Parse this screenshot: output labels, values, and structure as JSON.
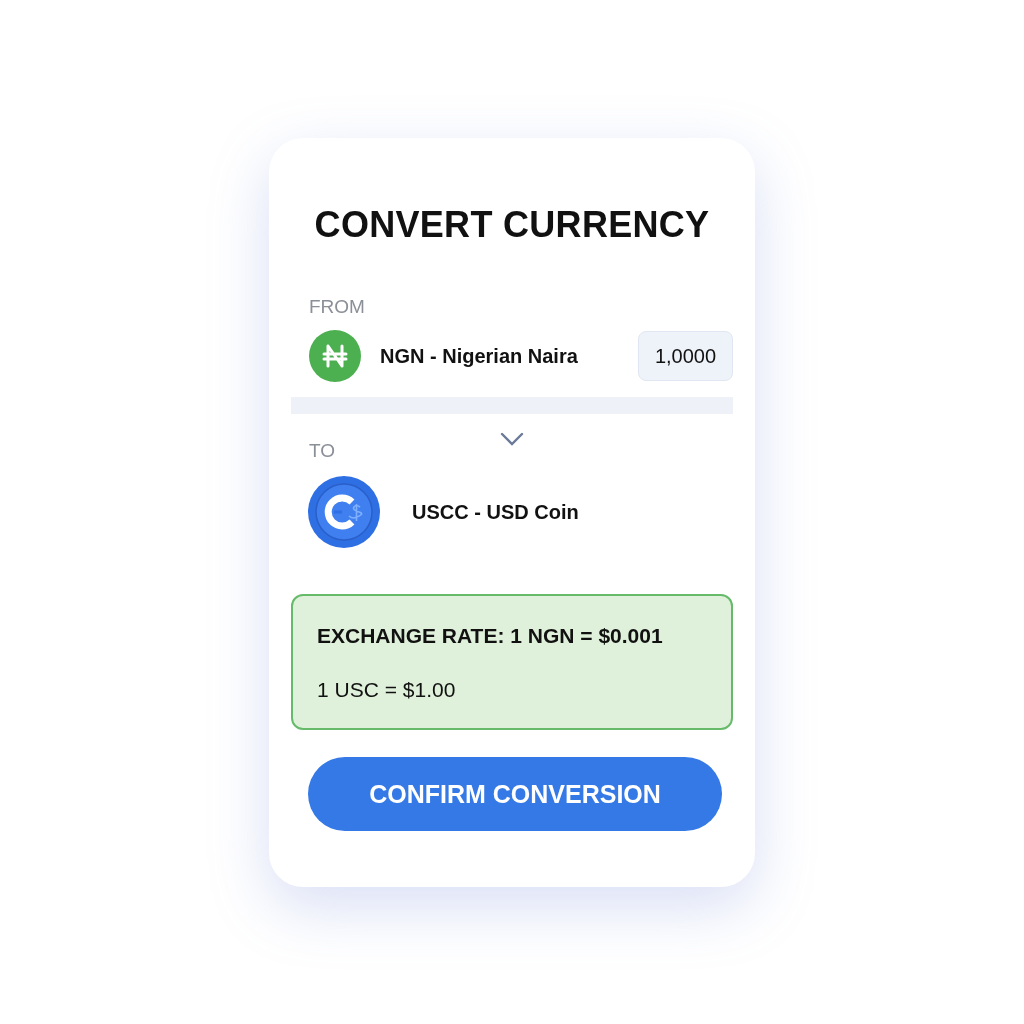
{
  "title": "CONVERT CURRENCY",
  "from": {
    "label": "FROM",
    "kind": "naira",
    "currency": "NGN - Nigerian Naira",
    "amount": "1,0000"
  },
  "to": {
    "label": "TO",
    "kind": "usdc",
    "currency": "USCC - USD Coin"
  },
  "rate": {
    "lines": [
      "EXCHANGE RATE: 1 NGN = $0.001",
      "1 USC = $1.00"
    ]
  },
  "button": "CONFIRM CONVERSION"
}
